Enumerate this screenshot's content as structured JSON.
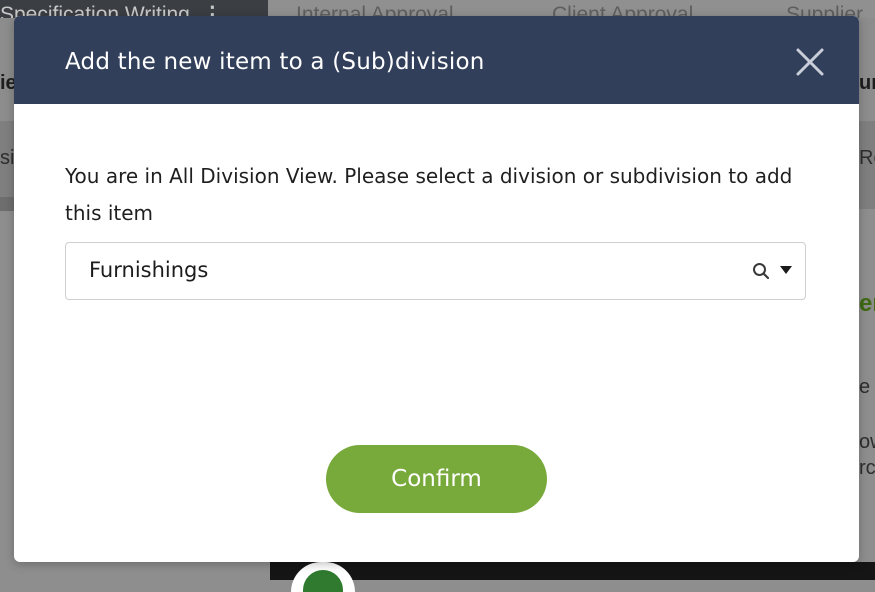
{
  "background": {
    "tabs": [
      {
        "label": "Specification Writing"
      },
      {
        "label": "Internal Approval"
      },
      {
        "label": "Client Approval"
      },
      {
        "label": "Supplier"
      }
    ],
    "fragments": {
      "row1_left": "ie",
      "row1_right": "ur",
      "row2_left": "si",
      "row2_right": "Re",
      "green_right": "er",
      "line_e": "e",
      "line_ow": "ow",
      "line_rc": "rc"
    }
  },
  "modal": {
    "title": "Add the new item to a (Sub)division",
    "prompt": "You are in All Division View. Please select a division or subdivision to add this item",
    "division_select": {
      "selected": "Furnishings"
    },
    "confirm_label": "Confirm"
  },
  "colors": {
    "header": "#323f5b",
    "confirm": "#78a93b",
    "overlay": "#8b8b8b"
  },
  "icons": {
    "close": "close-icon",
    "search": "search-icon",
    "dropdown": "caret-down-icon"
  }
}
